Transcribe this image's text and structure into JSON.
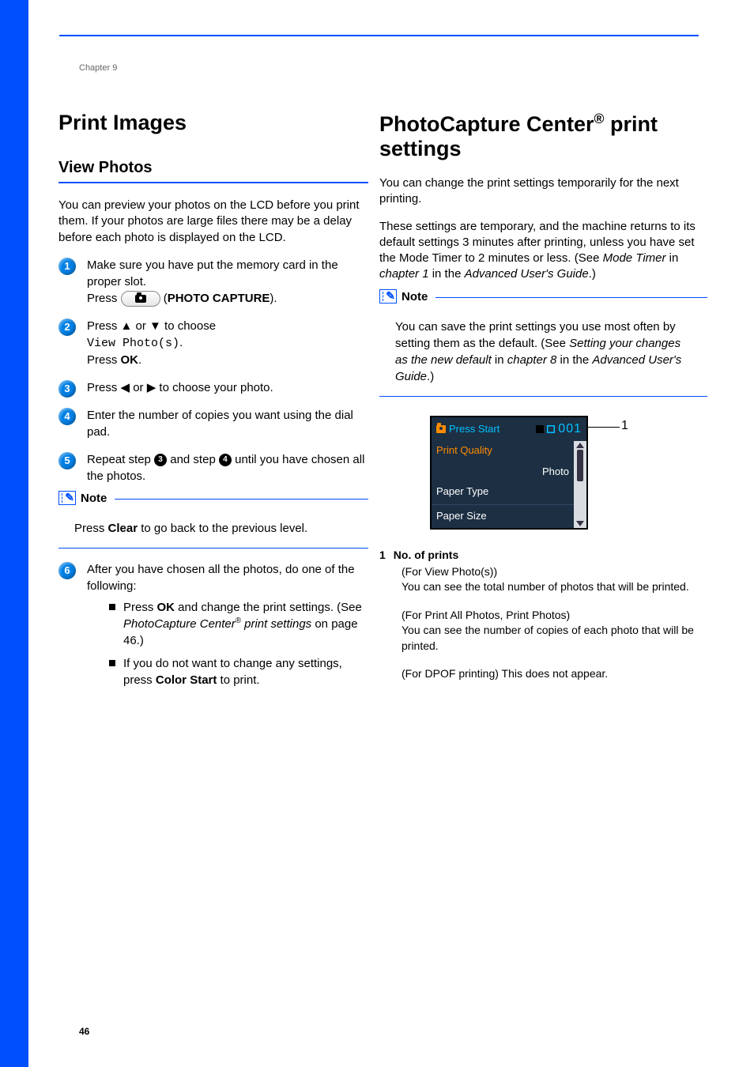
{
  "chapter_label": "Chapter 9",
  "page_number": "46",
  "left": {
    "h1": "Print Images",
    "h2": "View Photos",
    "intro": "You can preview your photos on the LCD before you print them. If your photos are large files there may be a delay before each photo is displayed on the LCD.",
    "steps": {
      "s1_a": "Make sure you have put the memory card in the proper slot.",
      "s1_b_pre": "Press ",
      "s1_b_post": " (",
      "s1_b_bold": "PHOTO CAPTURE",
      "s1_b_end": ").",
      "s2_a": "Press ▲ or ▼ to choose ",
      "s2_mono": "View Photo(s)",
      "s2_dot": ".",
      "s2_b": "Press ",
      "s2_ok": "OK",
      "s2_end": ".",
      "s3": "Press ◀ or ▶ to choose your photo.",
      "s4": "Enter the number of copies you want using the dial pad.",
      "s5_a": "Repeat step ",
      "s5_b": " and step ",
      "s5_c": " until you have chosen all the photos.",
      "s6": "After you have chosen all the photos, do one of the following:"
    },
    "note_title": "Note",
    "note_body_a": "Press ",
    "note_body_bold": "Clear",
    "note_body_b": " to go back to the previous level.",
    "bullets": {
      "b1_a": "Press ",
      "b1_ok": "OK",
      "b1_b": " and change the print settings. (See ",
      "b1_i": "PhotoCapture Center",
      "b1_sup": "®",
      "b1_i2": " print settings",
      "b1_c": " on page 46.)",
      "b2_a": "If you do not want to change any settings, press ",
      "b2_bold": "Color Start",
      "b2_b": " to print."
    },
    "nums": {
      "n1": "1",
      "n2": "2",
      "n3": "3",
      "n4": "4",
      "n5": "5",
      "n6": "6",
      "c3": "3",
      "c4": "4"
    }
  },
  "right": {
    "h1_a": "PhotoCapture Center",
    "h1_sup": "®",
    "h1_b": " print settings",
    "p1": "You can change the print settings temporarily for the next printing.",
    "p2_a": "These settings are temporary, and the machine returns to its default settings 3 minutes after printing, unless you have set the Mode Timer to 2 minutes or less. (See ",
    "p2_i1": "Mode Timer",
    "p2_b": " in ",
    "p2_i2": "chapter 1",
    "p2_c": " in the ",
    "p2_i3": "Advanced User's Guide",
    "p2_d": ".)",
    "note_title": "Note",
    "note_a": "You can save the print settings you use most often by setting them as the default. (See ",
    "note_i1": "Setting your changes as the new default",
    "note_b": " in ",
    "note_i2": "chapter 8",
    "note_c": " in the ",
    "note_i3": "Advanced User's Guide",
    "note_d": ".)",
    "lcd": {
      "press_start": "Press Start",
      "count": "001",
      "row1": "Print Quality",
      "row1_val": "Photo",
      "row2": "Paper Type",
      "row3": "Paper Size"
    },
    "callout": "1",
    "def": {
      "num": "1",
      "title": "No. of prints",
      "d1_a": "(For View Photo(s))",
      "d1_b": "You can see the total number of photos that will be printed.",
      "d2_a": "(For Print All Photos, Print Photos)",
      "d2_b": "You can see the number of copies of each photo that will be printed.",
      "d3": "(For DPOF printing) This does not appear."
    }
  }
}
